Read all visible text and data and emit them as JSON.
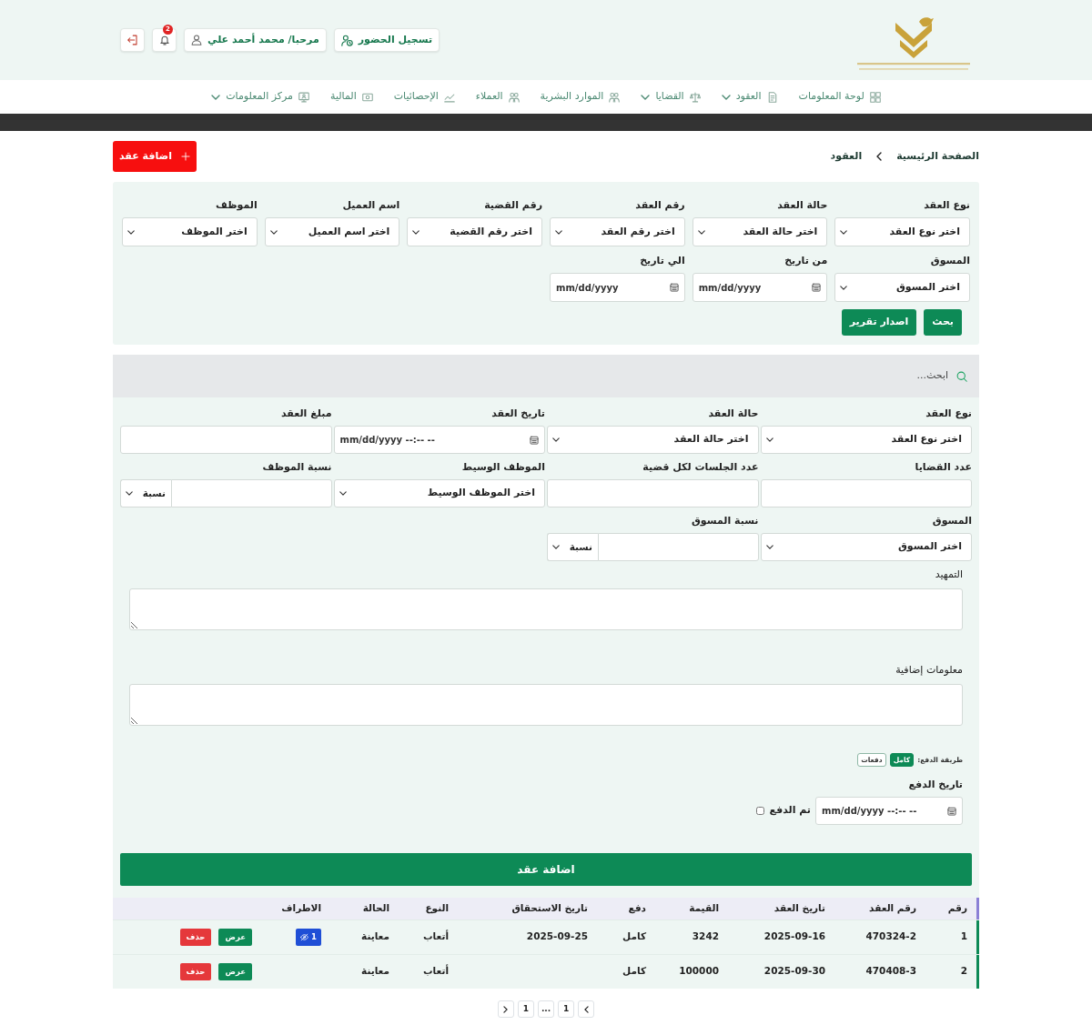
{
  "header": {
    "attendance_button": "تسجيل الحضور",
    "user_button": "مرحبا/ محمد أحمد علي",
    "notification_count": "2"
  },
  "nav": [
    {
      "label": "لوحة المعلومات",
      "kind": "link"
    },
    {
      "label": "العقود",
      "kind": "dropdown"
    },
    {
      "label": "القضايا",
      "kind": "dropdown"
    },
    {
      "label": "الموارد البشرية",
      "kind": "link"
    },
    {
      "label": "العملاء",
      "kind": "link"
    },
    {
      "label": "الإحصائيات",
      "kind": "link"
    },
    {
      "label": "المالية",
      "kind": "link"
    },
    {
      "label": "مركز المعلومات",
      "kind": "dropdown"
    }
  ],
  "breadcrumb": [
    "الصفحة الرئيسية",
    "العقود"
  ],
  "add_button": "اضافة عقد",
  "filters": {
    "fields": [
      {
        "label": "نوع العقد",
        "kind": "select",
        "value": "اختر نوع العقد"
      },
      {
        "label": "حالة العقد",
        "kind": "select",
        "value": "اختر حالة العقد"
      },
      {
        "label": "رقم العقد",
        "kind": "select",
        "value": "اختر رقم العقد"
      },
      {
        "label": "رقم القضية",
        "kind": "select",
        "value": "اختر رقم القضية"
      },
      {
        "label": "اسم العميل",
        "kind": "select",
        "value": "اختر اسم العميل"
      },
      {
        "label": "الموظف",
        "kind": "select",
        "value": "اختر الموظف"
      },
      {
        "label": "المسوق",
        "kind": "select",
        "value": "اختر المسوق"
      },
      {
        "label": "من تاريخ",
        "kind": "date",
        "placeholder": "mm/dd/yyyy"
      },
      {
        "label": "الي تاريخ",
        "kind": "date",
        "placeholder": "mm/dd/yyyy"
      }
    ],
    "buttons": [
      "بحث",
      "اصدار تقرير"
    ]
  },
  "search": {
    "placeholder": "ابحث..."
  },
  "form": {
    "fields": [
      {
        "label": "نوع العقد",
        "kind": "select",
        "value": "اختر نوع العقد"
      },
      {
        "label": "حالة العقد",
        "kind": "select",
        "value": "اختر حالة العقد"
      },
      {
        "label": "تاريخ العقد",
        "kind": "date",
        "placeholder": "mm/dd/yyyy --:-- --"
      },
      {
        "label": "مبلغ العقد",
        "kind": "text"
      },
      {
        "label": "عدد القضايا",
        "kind": "text"
      },
      {
        "label": "عدد الجلسات لكل قضية",
        "kind": "text"
      },
      {
        "label": "الموظف الوسيط",
        "kind": "select",
        "value": "اختر الموظف الوسيط"
      },
      {
        "label": "نسبة الموظف",
        "kind": "percent",
        "unit": "نسبة"
      },
      {
        "label": "المسوق",
        "kind": "select",
        "value": "اختر المسوق"
      },
      {
        "label": "نسبة المسوق",
        "kind": "percent",
        "unit": "نسبة"
      }
    ],
    "notes": [
      "التمهيد",
      "معلومات إضافية"
    ],
    "payment_method": {
      "label": "طريقة الدفع:",
      "options": [
        {
          "label": "كامل",
          "selected": true
        },
        {
          "label": "دفعات",
          "selected": false
        }
      ]
    },
    "payment_date": {
      "label": "تاريخ الدفع",
      "placeholder": "mm/dd/yyyy --:-- --"
    },
    "paid": {
      "label": "تم الدفع",
      "checked": false
    },
    "submit": "اضافة عقد"
  },
  "table": {
    "columns": [
      "رقم",
      "رقم العقد",
      "تاريخ العقد",
      "القيمة",
      "دفع",
      "تاريخ الاستحقاق",
      "النوع",
      "الحالة",
      "الاطراف"
    ],
    "rows": [
      {
        "number": "1",
        "contract_no": "470324-2",
        "contract_date": "2025-09-16",
        "value": "3242",
        "payment": "كامل",
        "due_date": "2025-09-25",
        "type": "أتعاب",
        "status": "معاينة",
        "parties": "1",
        "actions": [
          {
            "label": "عرض",
            "kind": "view"
          },
          {
            "label": "حذف",
            "kind": "delete"
          }
        ]
      },
      {
        "number": "2",
        "contract_no": "470408-3",
        "contract_date": "2025-09-30",
        "value": "100000",
        "payment": "كامل",
        "type": "أتعاب",
        "status": "معاينة",
        "actions": [
          {
            "label": "عرض",
            "kind": "view"
          },
          {
            "label": "حذف",
            "kind": "delete"
          }
        ]
      }
    ]
  },
  "pagination": [
    "1",
    "...",
    "1"
  ]
}
